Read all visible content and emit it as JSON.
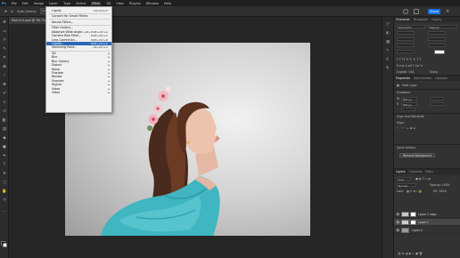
{
  "menubar": {
    "items": [
      "Ps",
      "File",
      "Edit",
      "Image",
      "Layer",
      "Type",
      "Select",
      "Filter",
      "3D",
      "View",
      "Plugins",
      "Window",
      "Help"
    ],
    "active_index": 7
  },
  "options_bar": {
    "auto_select": "Auto-Select:",
    "layer_value": "Layer",
    "share_label": "Share"
  },
  "doc_tab": {
    "title": "Pixlr112.psd @ 36.7% (Layer 1, RGB/8#) *"
  },
  "filter_menu": {
    "items": [
      {
        "label": "Liquify",
        "shortcut": "Alt+Ctrl+F",
        "type": "item"
      },
      {
        "type": "sep"
      },
      {
        "label": "Convert for Smart Filters",
        "shortcut": "",
        "type": "item"
      },
      {
        "type": "sep"
      },
      {
        "label": "Neural Filters...",
        "shortcut": "",
        "type": "item"
      },
      {
        "type": "sep"
      },
      {
        "label": "Filter Gallery...",
        "shortcut": "",
        "type": "item"
      },
      {
        "label": "Adaptive Wide Angle...",
        "shortcut": "Alt+Shift+Ctrl+A",
        "type": "item"
      },
      {
        "label": "Camera Raw Filter...",
        "shortcut": "Shift+Ctrl+A",
        "type": "item"
      },
      {
        "label": "Lens Correction...",
        "shortcut": "Shift+Ctrl+R",
        "type": "item"
      },
      {
        "label": "Liquify...",
        "shortcut": "Shift+Ctrl+X",
        "type": "item",
        "highlighted": true
      },
      {
        "label": "Vanishing Point...",
        "shortcut": "Alt+Ctrl+V",
        "type": "item"
      },
      {
        "type": "sep"
      },
      {
        "label": "3D",
        "shortcut": "",
        "type": "submenu"
      },
      {
        "label": "Blur",
        "shortcut": "",
        "type": "submenu"
      },
      {
        "label": "Blur Gallery",
        "shortcut": "",
        "type": "submenu"
      },
      {
        "label": "Distort",
        "shortcut": "",
        "type": "submenu"
      },
      {
        "label": "Noise",
        "shortcut": "",
        "type": "submenu"
      },
      {
        "label": "Pixelate",
        "shortcut": "",
        "type": "submenu"
      },
      {
        "label": "Render",
        "shortcut": "",
        "type": "submenu"
      },
      {
        "label": "Sharpen",
        "shortcut": "",
        "type": "submenu"
      },
      {
        "label": "Stylize",
        "shortcut": "",
        "type": "submenu"
      },
      {
        "label": "Video",
        "shortcut": "",
        "type": "submenu"
      },
      {
        "label": "Other",
        "shortcut": "",
        "type": "submenu"
      }
    ]
  },
  "right_panel": {
    "top_tabs": [
      "Character",
      "Paragraph",
      "Glyphs"
    ],
    "char_font": "Myriad Pro",
    "char_style": "Regular",
    "lang": "English: USA",
    "aa": "Sharp",
    "properties_tabs": [
      "Properties",
      "Adjustments",
      "Libraries"
    ],
    "pixel_layer": "Pixel Layer",
    "transform_label": "Transform",
    "w_val": "856 px",
    "h_val": "856 px",
    "align_label": "Align and Distribute",
    "align_sub": "Align:",
    "quick_actions": "Quick Actions",
    "remove_bg_button": "Remove Background",
    "layers_tabs": [
      "Layers",
      "Channels",
      "Paths"
    ],
    "kind_label": "Kind",
    "blend_mode": "Normal",
    "opacity": "Opacity: 100%",
    "lock_label": "Lock:",
    "fill": "Fill: 100%",
    "layers": [
      {
        "name": "Layer 1 copy",
        "selected": false,
        "thumb": "#c8c8c8"
      },
      {
        "name": "Layer 1",
        "selected": true,
        "thumb": "#cfcfcf"
      },
      {
        "name": "Layer 0",
        "selected": false,
        "thumb": "#9a9a9a"
      }
    ]
  },
  "colors": {
    "accent": "#1473e6",
    "menu_highlight": "#2c67b5",
    "dress": "#3fb6c1"
  }
}
